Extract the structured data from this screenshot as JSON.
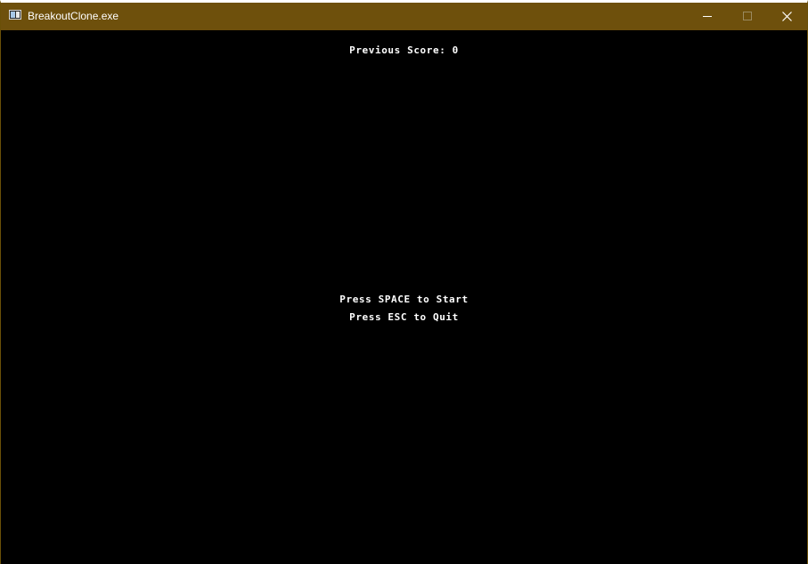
{
  "window": {
    "title": "BreakoutClone.exe",
    "titlebar_color": "#6e500c",
    "background_color": "#000000",
    "icon": "application-window-icon",
    "controls": {
      "minimize": "minimize-icon",
      "maximize": "maximize-icon",
      "close": "close-icon"
    }
  },
  "game": {
    "previous_score_text": "Previous Score: 0",
    "start_prompt": "Press SPACE to Start",
    "quit_prompt": "Press ESC to Quit",
    "text_color": "#ffffff"
  }
}
